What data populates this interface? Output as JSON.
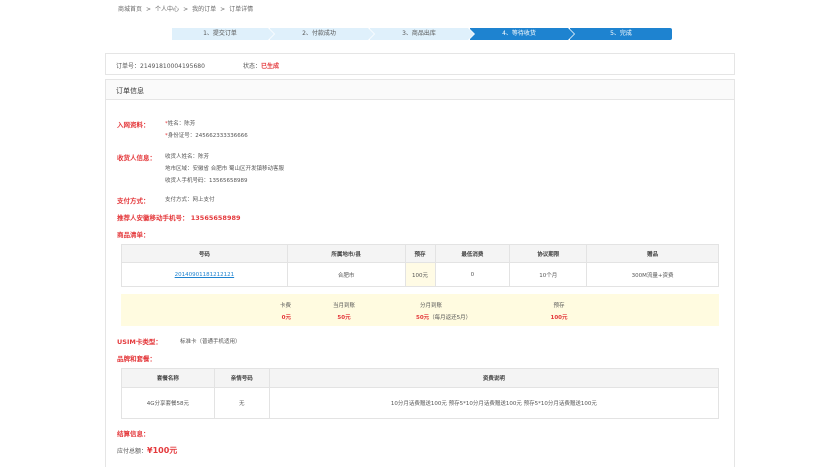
{
  "breadcrumb": {
    "items": [
      "商城首页",
      "个人中心",
      "我的订单",
      "订单详情"
    ],
    "separator": ">"
  },
  "steps": [
    {
      "label": "1、提交订单",
      "active": false
    },
    {
      "label": "2、付款成功",
      "active": false
    },
    {
      "label": "3、商品出库",
      "active": false
    },
    {
      "label": "4、等待收货",
      "active": true
    },
    {
      "label": "5、完成",
      "active": true
    }
  ],
  "order": {
    "number_text": "订单号：21491810004195680",
    "status_label": "状态：",
    "status_value": "已生成"
  },
  "info": {
    "title": "订单信息",
    "network": {
      "label": "入网资料：",
      "name": "姓名：陈芳",
      "id": "身份证号：245662333336666"
    },
    "receiver": {
      "label": "收货人信息：",
      "name": "收货人姓名：陈芳",
      "area": "地市区域：安徽省 合肥市 蜀山区开发镇移动客服",
      "phone": "收货人手机号码：13565658989"
    },
    "payment": {
      "label": "支付方式：",
      "value": "支付方式：网上支付"
    },
    "referrer": "推荐人安徽移动手机号：  13565658989",
    "product_list_label": "商品清单："
  },
  "product_table": {
    "headers": [
      "号码",
      "所属地市/县",
      "预存",
      "最低消费",
      "协议期限",
      "赠品"
    ],
    "rows": [
      [
        "20140901181212121",
        "合肥市",
        "100元",
        "0",
        "10个月",
        "300M流量+资费"
      ]
    ]
  },
  "summary": {
    "card_fee_label": "卡费",
    "card_fee_value": "0元",
    "month_label": "当月到账",
    "month_value": "50元",
    "split_label": "分月到账",
    "split_value": "50元",
    "split_note": "（每月返还5月）",
    "prestore_label": "预存",
    "prestore_value": "100元"
  },
  "usim": {
    "label": "USIM卡类型：",
    "value": "标准卡（普通手机适用）"
  },
  "brand_label": "品牌和套餐：",
  "package_table": {
    "headers": [
      "套餐名称",
      "亲情号码",
      "资费说明"
    ],
    "rows": [
      [
        "4G分享套餐58元",
        "无",
        "10分月话费赠送100元 预存5*10分月话费赠送100元 预存5*10分月话费赠送100元"
      ]
    ]
  },
  "settlement": {
    "label": "结算信息：",
    "total_label": "应付总额：",
    "total_value": "¥100元"
  },
  "colors": {
    "accent_blue": "#1e83d0",
    "red": "#e4393c",
    "step_inactive": "#dff0fb",
    "summary_bg": "#fffbe0"
  }
}
